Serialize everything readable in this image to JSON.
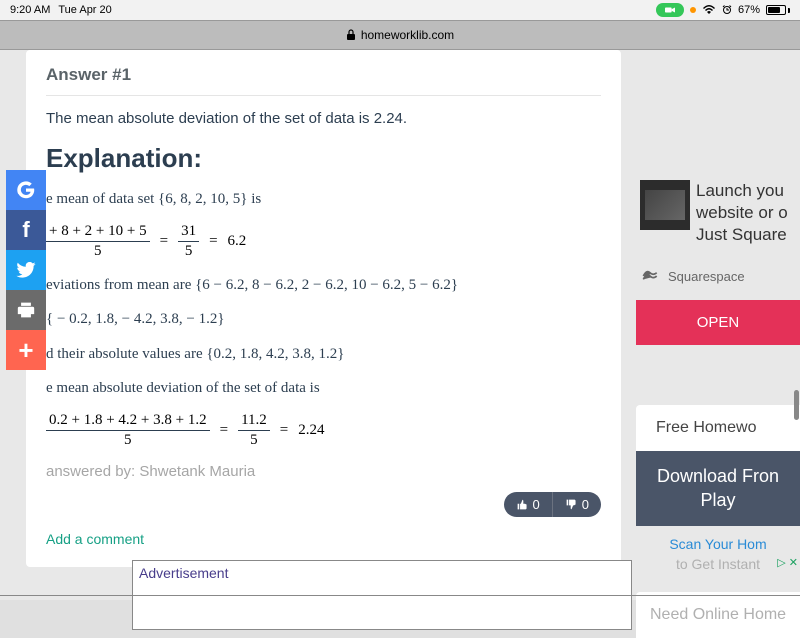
{
  "status": {
    "time": "9:20 AM",
    "date": "Tue Apr 20",
    "battery_pct": "67%"
  },
  "url": "homeworklib.com",
  "answer": {
    "header": "Answer #1",
    "summary": "The mean absolute deviation of the set of data is 2.24.",
    "explanation_heading": "Explanation:",
    "line1_prefix": "e mean of data set ",
    "line1_set": "{6, 8, 2, 10, 5}",
    "line1_suffix": " is",
    "frac1_num": "+ 8 + 2 + 10 + 5",
    "frac1_den": "5",
    "frac2_num": "31",
    "frac2_den": "5",
    "frac_result1": "6.2",
    "line2_prefix": "eviations from mean are ",
    "line2_set": "{6 − 6.2, 8 − 6.2, 2 − 6.2, 10 − 6.2, 5 − 6.2}",
    "line3_set": "{ − 0.2, 1.8,  − 4.2, 3.8,  − 1.2}",
    "line4_prefix": "d their absolute values are ",
    "line4_set": "{0.2, 1.8, 4.2, 3.8, 1.2}",
    "line5": "e mean absolute deviation of the set of data is",
    "frac3_num": "0.2 + 1.8 + 4.2 + 3.8 + 1.2",
    "frac3_den": "5",
    "frac4_num": "11.2",
    "frac4_den": "5",
    "frac_result2": "2.24",
    "attribution": "answered by: Shwetank Mauria",
    "upvotes": "0",
    "downvotes": "0",
    "add_comment": "Add a comment"
  },
  "share": {
    "google": "G",
    "facebook": "f",
    "more": "+"
  },
  "sidebar": {
    "ad_headline": "Launch you\nwebsite or o\nJust Square",
    "ad_headline_l1": "Launch you",
    "ad_headline_l2": "website or o",
    "ad_headline_l3": "Just Square",
    "advertiser": "Squarespace",
    "open": "OPEN",
    "free_hw": "Free Homewo",
    "download_l1": "Download Fron",
    "download_l2": "Play",
    "scan": "Scan Your Hom",
    "instant": "to Get Instant",
    "need": "Need Online Home"
  },
  "advert_label": "Advertisement",
  "eq": "="
}
